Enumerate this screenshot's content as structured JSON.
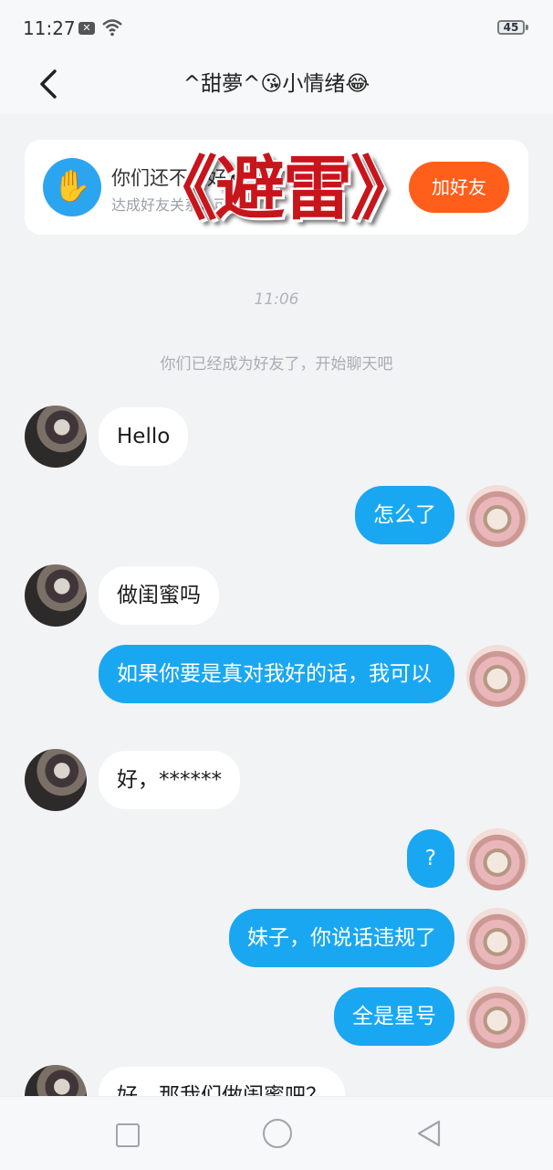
{
  "status": {
    "time": "11:27",
    "battery": "45"
  },
  "header": {
    "title": "^甜夢^😘小情绪😂"
  },
  "banner": {
    "title": "你们还不是好友",
    "subtitle": "达成好友关系，可以",
    "add_button": "加好友",
    "overlay": "《避雷》"
  },
  "chat": {
    "timestamp": "11:06",
    "system": "你们已经成为好友了，开始聊天吧",
    "messages": [
      {
        "side": "in",
        "text": "Hello"
      },
      {
        "side": "out",
        "text": "怎么了"
      },
      {
        "side": "in",
        "text": "做闺蜜吗"
      },
      {
        "side": "out",
        "text": "如果你要是真对我好的话，我可以"
      },
      {
        "side": "in",
        "text": "好，******"
      },
      {
        "side": "out",
        "text": "?"
      },
      {
        "side": "out",
        "text": "妹子，你说话违规了"
      },
      {
        "side": "out",
        "text": "全是星号"
      },
      {
        "side": "in",
        "text": "好，那我们做闺蜜吧？"
      }
    ]
  },
  "colors": {
    "outgoing_bubble": "#1aa7f2",
    "incoming_bubble": "#ffffff",
    "add_friend_button": "#ff5f1a",
    "overlay_text": "#c8151b"
  },
  "icons": [
    "back-arrow-icon",
    "hand-wave-icon",
    "wifi-icon",
    "nav-recent-icon",
    "nav-home-icon",
    "nav-back-icon"
  ]
}
